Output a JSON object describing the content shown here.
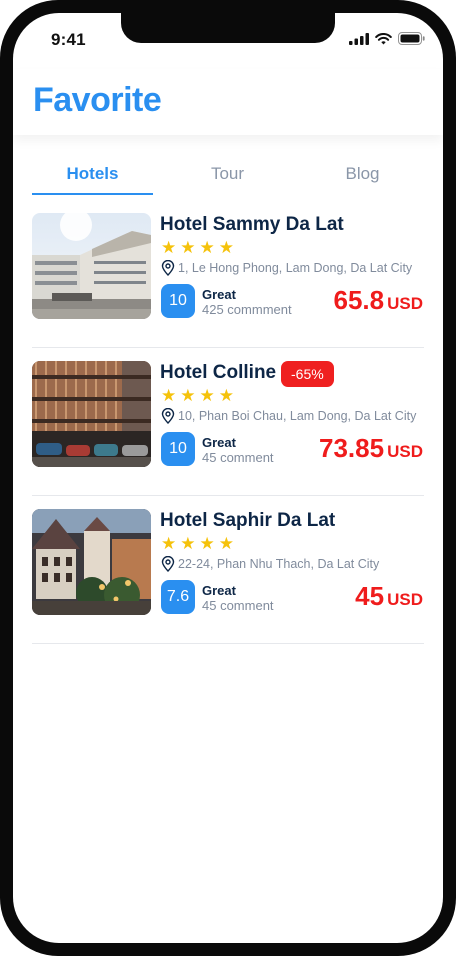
{
  "status": {
    "time": "9:41",
    "signal_icon": "cellular-signal-icon",
    "wifi_icon": "wifi-icon",
    "battery_icon": "battery-icon"
  },
  "header": {
    "title": "Favorite"
  },
  "tabs": [
    {
      "label": "Hotels",
      "active": true
    },
    {
      "label": "Tour",
      "active": false
    },
    {
      "label": "Blog",
      "active": false
    }
  ],
  "hotels": [
    {
      "name": "Hotel Sammy Da Lat",
      "badge": "",
      "stars": "★★★★",
      "star_count": 4,
      "address": "1, Le Hong Phong, Lam Dong, Da Lat City",
      "score": "10",
      "rating_word": "Great",
      "comments": "425 commment",
      "price": "65.8",
      "currency": "USD"
    },
    {
      "name": "Hotel Colline",
      "badge": "-65%",
      "stars": "★★★★",
      "star_count": 4,
      "address": "10, Phan Boi Chau, Lam Dong, Da Lat City",
      "score": "10",
      "rating_word": "Great",
      "comments": "45 comment",
      "price": "73.85",
      "currency": "USD"
    },
    {
      "name": "Hotel Saphir Da Lat",
      "badge": "",
      "stars": "★★★★",
      "star_count": 4,
      "address": "22-24, Phan Nhu Thach, Da Lat City",
      "score": "7.6",
      "rating_word": "Great",
      "comments": "45 comment",
      "price": "45",
      "currency": "USD"
    }
  ],
  "colors": {
    "accent": "#2a8ff0",
    "price": "#ef1c1c",
    "badge": "#ef2020",
    "star": "#f5c20b",
    "title_text": "#0d2646",
    "muted_text": "#808b9c"
  }
}
